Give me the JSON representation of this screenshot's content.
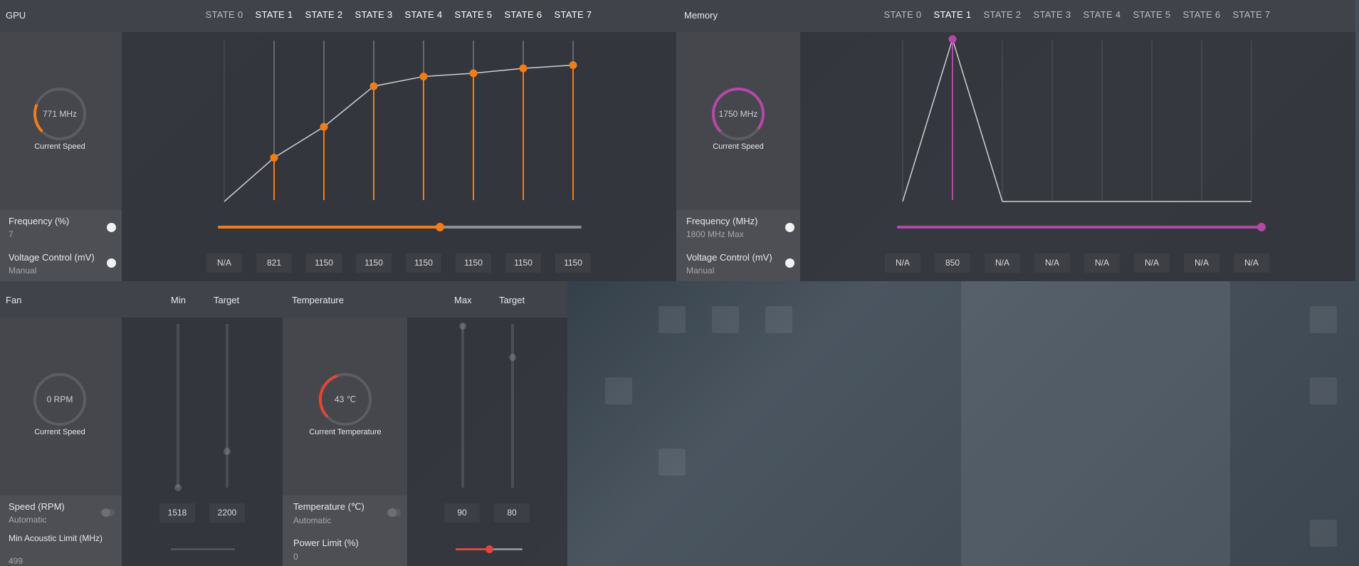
{
  "gpu": {
    "title": "GPU",
    "states": [
      "STATE 0",
      "STATE 1",
      "STATE 2",
      "STATE 3",
      "STATE 4",
      "STATE 5",
      "STATE 6",
      "STATE 7"
    ],
    "active_states": [
      1,
      2,
      3,
      4,
      5,
      6,
      7
    ],
    "gauge": {
      "value": "771 MHz",
      "label": "Current Speed",
      "level": 0.25
    },
    "curve_percent": [
      0,
      27,
      46,
      71,
      77,
      79,
      82,
      84
    ],
    "frequency": {
      "title": "Frequency (%)",
      "value": "7",
      "slider_level": 0.61
    },
    "voltage": {
      "title": "Voltage Control (mV)",
      "mode": "Manual",
      "values": [
        "N/A",
        "821",
        "1150",
        "1150",
        "1150",
        "1150",
        "1150",
        "1150"
      ]
    },
    "accent": "#f57c14"
  },
  "memory": {
    "title": "Memory",
    "states": [
      "STATE 0",
      "STATE 1",
      "STATE 2",
      "STATE 3",
      "STATE 4",
      "STATE 5",
      "STATE 6",
      "STATE 7"
    ],
    "active_states": [
      1
    ],
    "gauge": {
      "value": "1750 MHz",
      "label": "Current Speed",
      "level": 0.97
    },
    "curve_percent": [
      0,
      100,
      0,
      0,
      0,
      0,
      0,
      0
    ],
    "frequency": {
      "title": "Frequency (MHz)",
      "value": "1800 MHz Max",
      "slider_level": 1.0
    },
    "voltage": {
      "title": "Voltage Control (mV)",
      "mode": "Manual",
      "values": [
        "N/A",
        "850",
        "N/A",
        "N/A",
        "N/A",
        "N/A",
        "N/A",
        "N/A"
      ]
    },
    "accent": "#b448a8"
  },
  "fan": {
    "title": "Fan",
    "col_min": "Min",
    "col_target": "Target",
    "gauge": {
      "value": "0 RPM",
      "label": "Current Speed",
      "level": 0.0
    },
    "speed": {
      "title": "Speed (RPM)",
      "mode": "Automatic",
      "min": "1518",
      "target": "2200"
    },
    "acoustic": {
      "title": "Min Acoustic Limit (MHz)",
      "value": "499"
    }
  },
  "temperature": {
    "title": "Temperature",
    "col_max": "Max",
    "col_target": "Target",
    "gauge": {
      "value": "43 ℃",
      "label": "Current Temperature",
      "level": 0.43
    },
    "temp": {
      "title": "Temperature (℃)",
      "mode": "Automatic",
      "max": "90",
      "target": "80"
    },
    "power": {
      "title": "Power Limit (%)",
      "value": "0",
      "slider_level": 0.5
    },
    "accent": "#e0463c"
  }
}
